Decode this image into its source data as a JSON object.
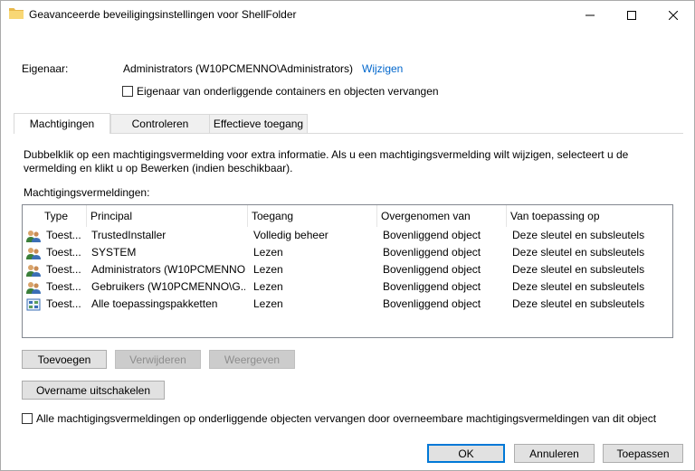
{
  "window": {
    "title": "Geavanceerde beveiligingsinstellingen voor ShellFolder",
    "icon": "folder-icon"
  },
  "owner": {
    "label": "Eigenaar:",
    "value": "Administrators (W10PCMENNO\\Administrators)",
    "change_link": "Wijzigen",
    "replace_checkbox_label": "Eigenaar van onderliggende containers en objecten vervangen",
    "replace_checked": false
  },
  "tabs": [
    {
      "label": "Machtigingen",
      "active": true
    },
    {
      "label": "Controleren",
      "active": false
    },
    {
      "label": "Effectieve toegang",
      "active": false
    }
  ],
  "permissions": {
    "description": "Dubbelklik op een machtigingsvermelding voor extra informatie. Als u een machtigingsvermelding wilt wijzigen, selecteert u de vermelding en klikt u op Bewerken (indien beschikbaar).",
    "entries_label": "Machtigingsvermeldingen:",
    "columns": [
      "Type",
      "Principal",
      "Toegang",
      "Overgenomen van",
      "Van toepassing op"
    ],
    "rows": [
      {
        "icon": "users-icon",
        "type": "Toest...",
        "principal": "TrustedInstaller",
        "access": "Volledig beheer",
        "inherited": "Bovenliggend object",
        "applies": "Deze sleutel en subsleutels"
      },
      {
        "icon": "users-icon",
        "type": "Toest...",
        "principal": "SYSTEM",
        "access": "Lezen",
        "inherited": "Bovenliggend object",
        "applies": "Deze sleutel en subsleutels"
      },
      {
        "icon": "users-icon",
        "type": "Toest...",
        "principal": "Administrators (W10PCMENNO...",
        "access": "Lezen",
        "inherited": "Bovenliggend object",
        "applies": "Deze sleutel en subsleutels"
      },
      {
        "icon": "users-icon",
        "type": "Toest...",
        "principal": "Gebruikers (W10PCMENNO\\G...",
        "access": "Lezen",
        "inherited": "Bovenliggend object",
        "applies": "Deze sleutel en subsleutels"
      },
      {
        "icon": "app-packages-icon",
        "type": "Toest...",
        "principal": "Alle toepassingspakketten",
        "access": "Lezen",
        "inherited": "Bovenliggend object",
        "applies": "Deze sleutel en subsleutels"
      }
    ],
    "add_button": "Toevoegen",
    "remove_button": "Verwijderen",
    "view_button": "Weergeven",
    "disable_inheritance_button": "Overname uitschakelen",
    "replace_all_label": "Alle machtigingsvermeldingen op onderliggende objecten vervangen door overneembare machtigingsvermeldingen van dit object",
    "replace_all_checked": false
  },
  "footer": {
    "ok": "OK",
    "cancel": "Annuleren",
    "apply": "Toepassen"
  },
  "colors": {
    "link": "#0066cc",
    "primary_border": "#0078d7"
  }
}
